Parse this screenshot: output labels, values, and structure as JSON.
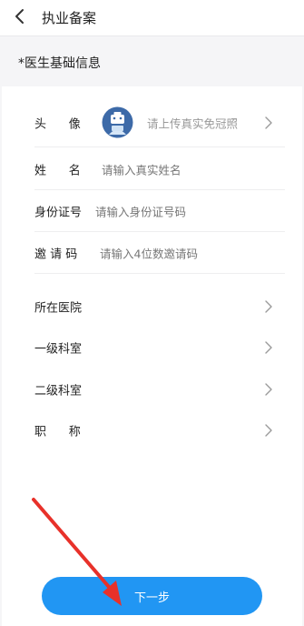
{
  "header": {
    "title": "执业备案"
  },
  "section": {
    "title": "*医生基础信息"
  },
  "form": {
    "avatar": {
      "label": "头      像",
      "hint": "请上传真实免冠照"
    },
    "name": {
      "label": "姓      名",
      "placeholder": "请输入真实姓名"
    },
    "id_number": {
      "label": "身份证号",
      "placeholder": "请输入身份证号码"
    },
    "invite_code": {
      "label": "邀 请 码",
      "placeholder": "请输入4位数邀请码"
    },
    "hospital": {
      "label": "所在医院"
    },
    "dept_level1": {
      "label": "一级科室"
    },
    "dept_level2": {
      "label": "二级科室"
    },
    "job_title": {
      "label": "职      称"
    }
  },
  "actions": {
    "next_label": "下一步"
  },
  "colors": {
    "accent": "#2196f3",
    "annotation_arrow": "#e8312a"
  },
  "icons": [
    "back-arrow-icon",
    "avatar-icon",
    "chevron-right-icon"
  ]
}
